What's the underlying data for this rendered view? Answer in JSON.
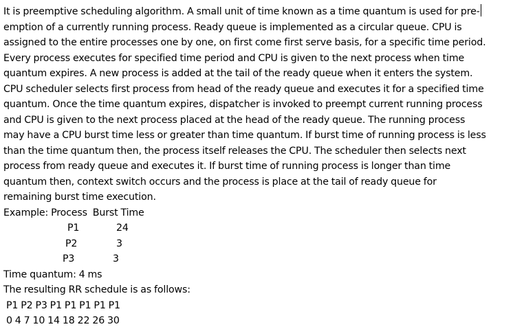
{
  "paragraph_lines": [
    "It is preemptive scheduling algorithm. A small unit of time known as a time quantum is used for pre-",
    "emption of a currently running process. Ready queue is implemented as a circular queue. CPU is",
    "assigned to the entire processes one by one, on first come first serve basis, for a specific time period.",
    "Every process executes for specified time period and CPU is given to the next process when time",
    "quantum expires. A new process is added at the tail of the ready queue when it enters the system.",
    "CPU scheduler selects first process from head of the ready queue and executes it for a specified time",
    "quantum. Once the time quantum expires, dispatcher is invoked to preempt current running process",
    "and CPU is given to the next process placed at the head of the ready queue. The running process",
    "may have a CPU burst time less or greater than time quantum. If burst time of running process is less",
    "than the time quantum then, the process itself releases the CPU. The scheduler then selects next",
    "process from ready queue and executes it. If burst time of running process is longer than time",
    "quantum then, context switch occurs and the process is place at the tail of ready queue for",
    "remaining burst time execution."
  ],
  "example_header": "Example: Process  Burst Time",
  "processes": [
    {
      "name": "P1",
      "burst": "24"
    },
    {
      "name": "P2",
      "burst": "3"
    },
    {
      "name": "P3",
      "burst": "3"
    }
  ],
  "time_quantum": "Time quantum: 4 ms",
  "schedule_intro": "The resulting RR schedule is as follows:",
  "schedule_sequence": " P1 P2 P3 P1 P1 P1 P1 P1",
  "schedule_times": " 0 4 7 10 14 18 22 26 30"
}
